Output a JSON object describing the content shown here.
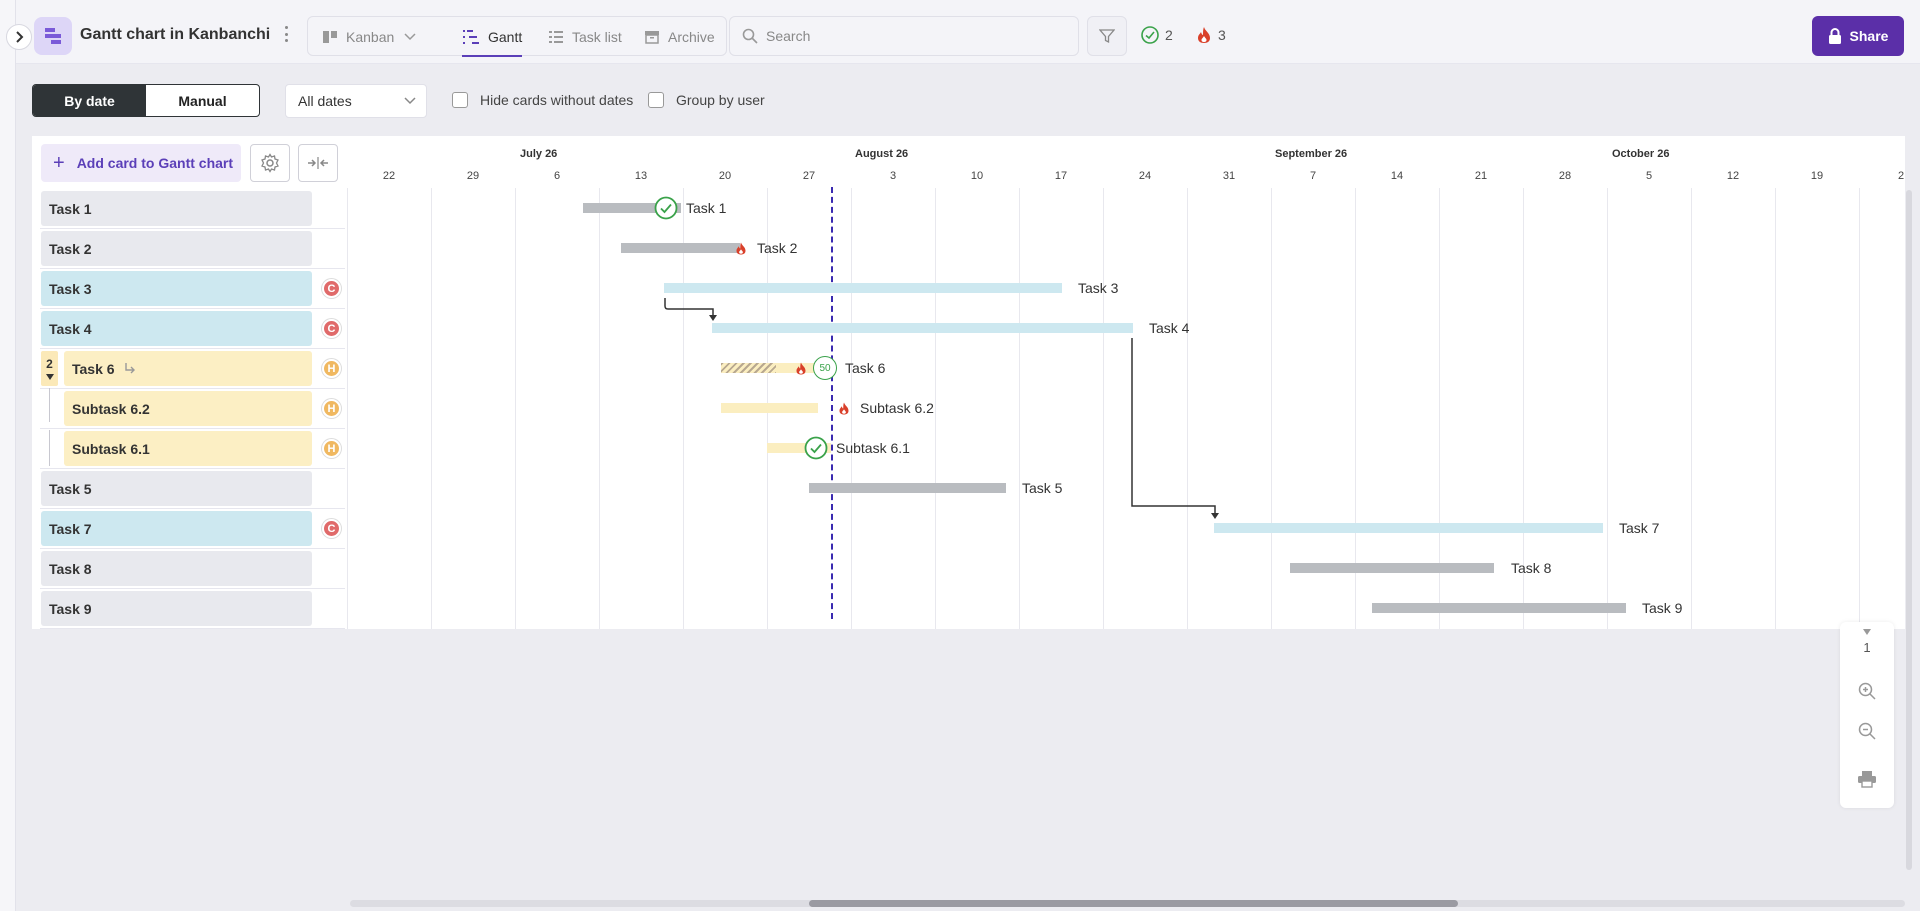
{
  "header": {
    "board_title": "Gantt chart in Kanbanchi",
    "views": {
      "kanban": "Kanban",
      "gantt": "Gantt",
      "task_list": "Task list",
      "archive": "Archive"
    },
    "search_placeholder": "Search",
    "done_count": "2",
    "urgent_count": "3",
    "share_label": "Share"
  },
  "toolbar": {
    "by_date": "By date",
    "manual": "Manual",
    "dates_select": "All dates",
    "hide_cards_without_dates": "Hide cards without dates",
    "group_by_user": "Group by user",
    "add_card": "Add card to Gantt chart"
  },
  "timeline": {
    "months": [
      "July 26",
      "August 26",
      "September 26",
      "October 26"
    ],
    "days": [
      "22",
      "29",
      "6",
      "13",
      "20",
      "27",
      "3",
      "10",
      "17",
      "24",
      "31",
      "7",
      "14",
      "21",
      "28",
      "5",
      "12",
      "19",
      "2"
    ]
  },
  "rows": [
    {
      "label": "Task 1",
      "bar_label": "Task 1",
      "color": "#e8e9ee"
    },
    {
      "label": "Task 2",
      "bar_label": "Task 2",
      "color": "#e8e9ee"
    },
    {
      "label": "Task 3",
      "bar_label": "Task 3",
      "color": "#cde8f0",
      "badge": "C"
    },
    {
      "label": "Task 4",
      "bar_label": "Task 4",
      "color": "#cde8f0",
      "badge": "C"
    },
    {
      "label": "Task 6",
      "bar_label": "Task 6",
      "color": "#fcefc4",
      "badge": "H",
      "subtask_count": "2",
      "progress": "50"
    },
    {
      "label": "Subtask 6.2",
      "bar_label": "Subtask 6.2",
      "color": "#fcefc4",
      "badge": "H"
    },
    {
      "label": "Subtask 6.1",
      "bar_label": "Subtask 6.1",
      "color": "#fcefc4",
      "badge": "H"
    },
    {
      "label": "Task 5",
      "bar_label": "Task 5",
      "color": "#e8e9ee"
    },
    {
      "label": "Task 7",
      "bar_label": "Task 7",
      "color": "#cde8f0",
      "badge": "C"
    },
    {
      "label": "Task 8",
      "bar_label": "Task 8",
      "color": "#e8e9ee"
    },
    {
      "label": "Task 9",
      "bar_label": "Task 9",
      "color": "#e8e9ee"
    }
  ],
  "zoom": {
    "page_number": "1"
  },
  "colors": {
    "accent": "#5b2fa8",
    "today_line": "#3a2ab0",
    "done": "#3aa24a",
    "urgent": "#d9402a"
  }
}
